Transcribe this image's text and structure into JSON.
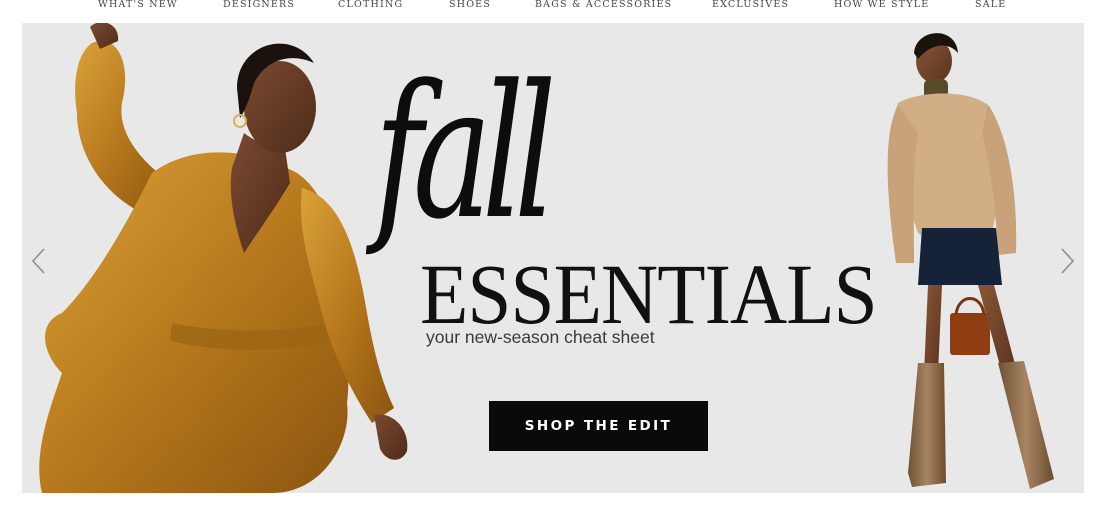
{
  "nav": {
    "items": [
      "WHAT'S NEW",
      "DESIGNERS",
      "CLOTHING",
      "SHOES",
      "BAGS & ACCESSORIES",
      "EXCLUSIVES",
      "HOW WE STYLE",
      "SALE"
    ]
  },
  "hero": {
    "headline_script": "fall",
    "headline_main": "ESSENTIALS",
    "subtitle": "your new-season cheat sheet",
    "cta_label": "SHOP THE EDIT",
    "icons": {
      "prev": "chevron-left-icon",
      "next": "chevron-right-icon"
    },
    "colors": {
      "background": "#e9e8e8",
      "cta_background": "#0a0a0a",
      "cta_text": "#ffffff",
      "gold_dress": "#b8791c",
      "sweater": "#d2ae86",
      "boots": "#8a6a4a"
    }
  }
}
